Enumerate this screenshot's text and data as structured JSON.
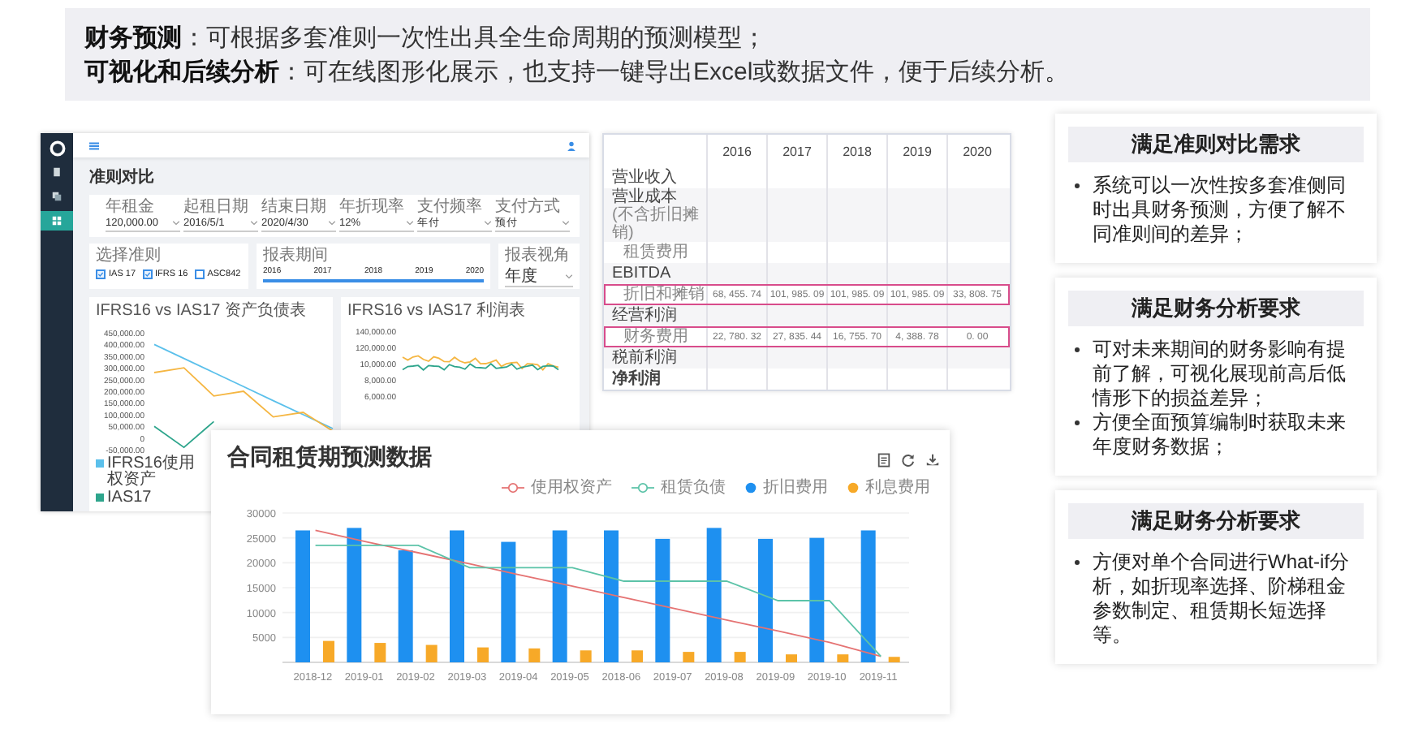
{
  "banner": {
    "lines": [
      "**财务预测**：可根据多套准则一次性出具全生命周期的预测模型；",
      "**可视化和后续分析**：可在线图形化展示，也支持一键导出Excel或数据文件，便于后续分析。"
    ]
  },
  "app_screen": {
    "sidebar": {
      "items": [
        {
          "kind": "document",
          "selected": false
        },
        {
          "kind": "layers",
          "selected": false
        },
        {
          "kind": "grid",
          "selected": true
        }
      ]
    },
    "page_title": "准则对比",
    "fields": [
      {
        "label": "年租金",
        "value": "120,000.00"
      },
      {
        "label": "起租日期",
        "value": "2016/5/1"
      },
      {
        "label": "结束日期",
        "value": "2020/4/30"
      },
      {
        "label": "年折现率",
        "value": "12%"
      },
      {
        "label": "支付频率",
        "value": "年付"
      },
      {
        "label": "支付方式",
        "value": "预付"
      }
    ],
    "standards": {
      "label": "选择准则",
      "options": [
        {
          "label": "IAS 17",
          "checked": true
        },
        {
          "label": "IFRS 16",
          "checked": true
        },
        {
          "label": "ASC842",
          "checked": false
        }
      ]
    },
    "period": {
      "label": "报表期间",
      "ticks": [
        "2016",
        "2017",
        "2018",
        "2019",
        "2020"
      ],
      "level": 1
    },
    "view": {
      "label": "报表视角",
      "value": "年度"
    },
    "charts": [
      {
        "title": "IFRS16 vs IAS17 资产负债表",
        "chart_data": {
          "type": "line",
          "legend": "bottom",
          "ylim": [
            -50000,
            450000
          ],
          "yticks": [
            {
              "value": 450000,
              "label": "450,000.00"
            },
            {
              "value": 400000,
              "label": "400,000.00"
            },
            {
              "value": 350000,
              "label": "350,000.00"
            },
            {
              "value": 300000,
              "label": "300,000.00"
            },
            {
              "value": 250000,
              "label": "250,000.00"
            },
            {
              "value": 200000,
              "label": "200,000.00"
            },
            {
              "value": 150000,
              "label": "150,000.00"
            },
            {
              "value": 100000,
              "label": "100,000.00"
            },
            {
              "value": 50000,
              "label": "50,000.00"
            },
            {
              "value": 0,
              "label": "0"
            },
            {
              "value": -50000,
              "label": "-50,000.00"
            }
          ],
          "series": [
            {
              "name": "IFRS16使用权资产",
              "color": "#5bc0eb",
              "values": [
                400000,
                340000,
                280000,
                220000,
                160000,
                100000,
                40000
              ]
            },
            {
              "color": "#f5b642",
              "values": [
                280000,
                300000,
                180000,
                200000,
                90000,
                110000,
                30000
              ]
            },
            {
              "name": "IAS17",
              "color": "#2ea58c",
              "values": [
                50000,
                -40000,
                70000,
                null,
                null,
                null,
                null
              ]
            }
          ]
        }
      },
      {
        "title": "IFRS16 vs IAS17 利润表",
        "axis_labels": [
          "140,000.00",
          "120,000.00",
          "10,000.00",
          "8,000.00",
          "6,000.00"
        ]
      }
    ]
  },
  "table": {
    "columns": [
      "2016",
      "2017",
      "2018",
      "2019",
      "2020"
    ],
    "rows": [
      {
        "label": "营业收入",
        "kind": "item",
        "highlighted": false
      },
      {
        "label": "营业成本",
        "note": "(不含折旧摊销)",
        "kind": "item",
        "highlighted": false
      },
      {
        "label": "租赁费用",
        "kind": "sub",
        "highlighted": false
      },
      {
        "label": "EBITDA",
        "kind": "item",
        "highlighted": false
      },
      {
        "label": "折旧和摊销",
        "kind": "sub",
        "highlighted": true,
        "cells": [
          "68, 455. 74",
          "101, 985. 09",
          "101, 985. 09",
          "101, 985. 09",
          "33, 808. 75"
        ]
      },
      {
        "label": "经营利润",
        "kind": "item",
        "highlighted": false
      },
      {
        "label": "财务费用",
        "kind": "sub",
        "highlighted": true,
        "cells": [
          "22, 780. 32",
          "27, 835. 44",
          "16, 755. 70",
          "4, 388. 78",
          "0. 00"
        ]
      },
      {
        "label": "税前利润",
        "kind": "item",
        "highlighted": false
      },
      {
        "label": "净利润",
        "kind": "total",
        "highlighted": false
      }
    ]
  },
  "forecast_card": {
    "title": "合同租赁期预测数据",
    "chart_data": {
      "type": "bar",
      "grid": true,
      "categories": [
        "2018-12",
        "2019-01",
        "2019-02",
        "2019-03",
        "2019-04",
        "2019-05",
        "2018-06",
        "2019-07",
        "2019-08",
        "2019-09",
        "2019-10",
        "2019-11"
      ],
      "ylim": [
        0,
        30000
      ],
      "yticks": [
        5000,
        10000,
        15000,
        20000,
        25000,
        30000
      ],
      "series": [
        {
          "name": "使用权资产",
          "type": "line",
          "color": "#e57373",
          "values": [
            26500,
            24200,
            22000,
            19800,
            17500,
            15300,
            13000,
            10800,
            8500,
            6300,
            4000,
            1200
          ]
        },
        {
          "name": "租赁负债",
          "type": "line",
          "color": "#5cc3a8",
          "values": [
            23500,
            23500,
            23500,
            19000,
            19000,
            19000,
            16300,
            16300,
            16300,
            12400,
            12400,
            1200
          ]
        },
        {
          "name": "折旧费用",
          "type": "bar",
          "color": "#1e90f0",
          "values": [
            26500,
            27000,
            22500,
            26500,
            24200,
            26500,
            26500,
            24800,
            27000,
            24800,
            25000,
            26500
          ]
        },
        {
          "name": "利息费用",
          "type": "bar",
          "color": "#f7a928",
          "values": [
            4300,
            3900,
            3500,
            3000,
            2800,
            2400,
            2400,
            2100,
            2100,
            1600,
            1600,
            1100
          ]
        }
      ]
    }
  },
  "cards": [
    {
      "title": "满足准则对比需求",
      "bullets": [
        "系统可以一次性按多套准侧同时出具财务预测，方便了解不同准则间的差异；"
      ]
    },
    {
      "title": "满足财务分析要求",
      "bullets": [
        "可对未来期间的财务影响有提前了解，可视化展现前高后低情形下的损益差异；",
        "方便全面预算编制时获取未来年度财务数据；"
      ]
    },
    {
      "title": "满足财务分析要求",
      "bullets": [
        "方便对单个合同进行What-if分析，如折现率选择、阶梯租金参数制定、租赁期长短选择等。"
      ]
    }
  ]
}
